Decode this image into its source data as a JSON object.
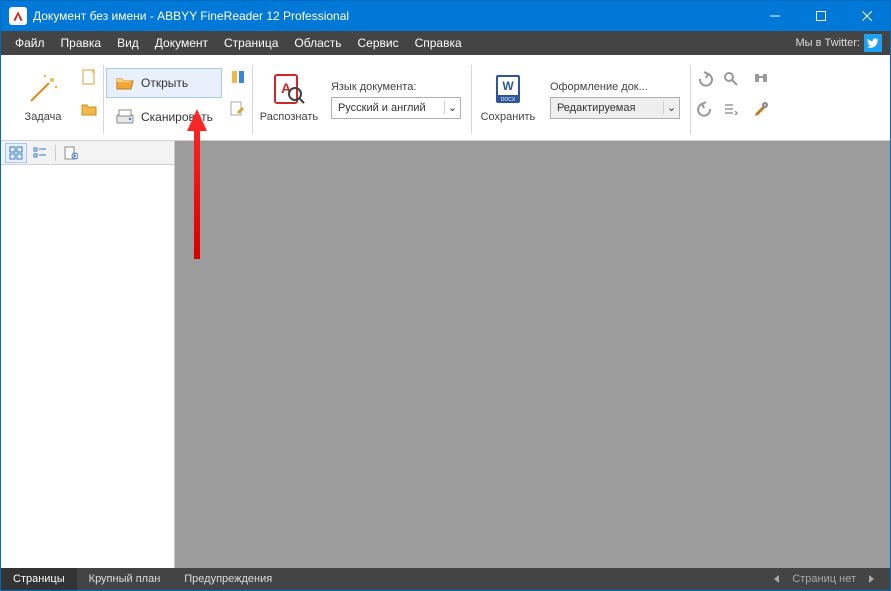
{
  "titlebar": {
    "title": "Документ без имени - ABBYY FineReader 12 Professional"
  },
  "menu": {
    "items": [
      "Файл",
      "Правка",
      "Вид",
      "Документ",
      "Страница",
      "Область",
      "Сервис",
      "Справка"
    ],
    "twitter_label": "Мы в Twitter:"
  },
  "ribbon": {
    "task": "Задача",
    "open": "Открыть",
    "scan": "Сканировать",
    "recognize": "Распознать",
    "lang_label": "Язык документа:",
    "lang_value": "Русский и англий",
    "save": "Сохранить",
    "layout_label": "Оформление док...",
    "layout_value": "Редактируемая"
  },
  "statusbar": {
    "tabs": [
      "Страницы",
      "Крупный план",
      "Предупреждения"
    ],
    "nav_label": "Страниц нет"
  }
}
